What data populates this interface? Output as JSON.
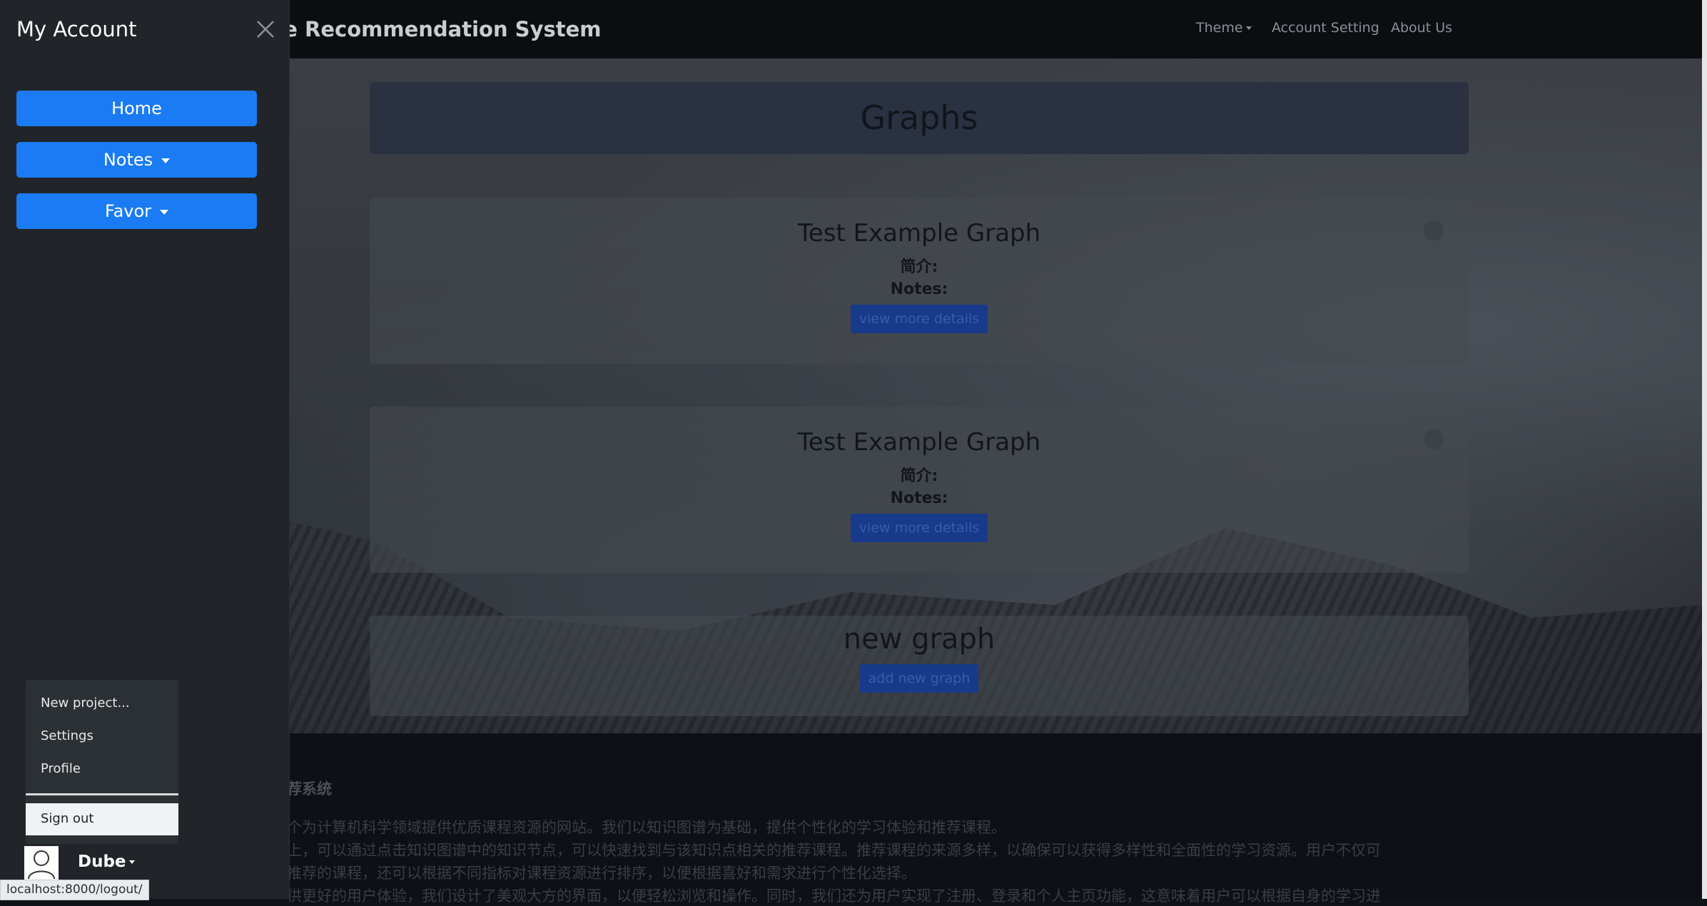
{
  "navbar": {
    "brand": "se Recommendation System",
    "links": [
      "Theme",
      "Account Setting",
      "About Us"
    ]
  },
  "main": {
    "header_title": "Graphs",
    "graphs": [
      {
        "title": "Test Example Graph",
        "intro_label": "简介:",
        "notes_label": "Notes:",
        "button": "view more details"
      },
      {
        "title": "Test Example Graph",
        "intro_label": "简介:",
        "notes_label": "Notes:",
        "button": "view more details"
      }
    ],
    "new_graph": {
      "title": "new graph",
      "button": "add new graph"
    }
  },
  "footer": {
    "title": "荐系统",
    "lines": [
      "个为计算机科学领域提供优质课程资源的网站。我们以知识图谱为基础，提供个性化的学习体验和推荐课程。",
      "上，可以通过点击知识图谱中的知识节点，可以快速找到与该知识点相关的推荐课程。推荐课程的来源多样，以确保可以获得多样性和全面性的学习资源。用户不仅可",
      "推荐的课程，还可以根据不同指标对课程资源进行排序，以便根据喜好和需求进行个性化选择。",
      "供更好的用户体验，我们设计了美观大方的界面，以便轻松浏览和操作。同时，我们还为用户实现了注册、登录和个人主页功能，这意味着用户可以根据自身的学习进"
    ]
  },
  "sidebar": {
    "title": "My Account",
    "buttons": [
      "Home",
      "Notes",
      "Favor"
    ],
    "dropdown": {
      "items": [
        "New project...",
        "Settings",
        "Profile"
      ],
      "signout": "Sign out"
    },
    "user": {
      "name": "Dube"
    }
  },
  "status_url": "localhost:8000/logout/"
}
